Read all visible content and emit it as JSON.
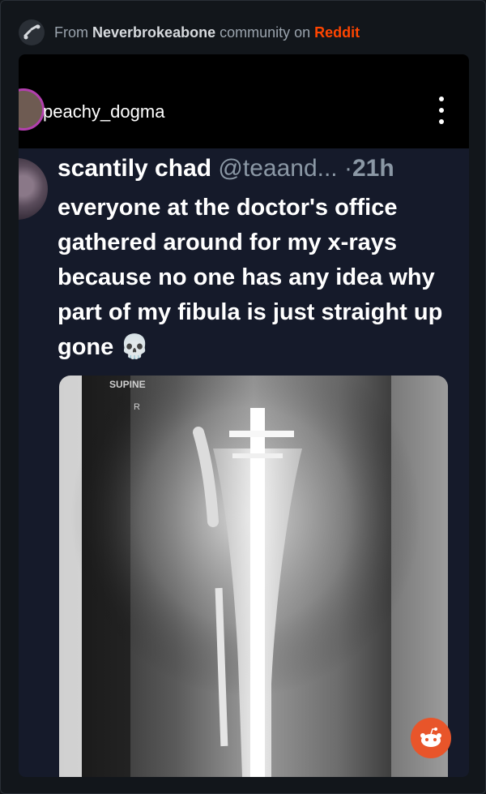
{
  "header": {
    "prefix": "From",
    "community": "Neverbrokeabone",
    "middle": "community on",
    "platform": "Reddit",
    "icon": "broken-bone-icon"
  },
  "post": {
    "username": "peachy_dogma",
    "menu_icon": "vertical-ellipsis-icon"
  },
  "tweet": {
    "display_name": "scantily chad",
    "handle": "@teaand...",
    "separator": "·",
    "time": "21h",
    "text": "everyone at the doctor's office gathered around for my x-rays because no one has any idea why part of my fibula is just straight up gone",
    "emoji": "💀"
  },
  "xray": {
    "label_top": "SUPINE",
    "label_side": "R"
  },
  "colors": {
    "reddit_orange": "#ff4500",
    "card_bg": "#151a2a",
    "handle_gray": "#8b98a5"
  }
}
